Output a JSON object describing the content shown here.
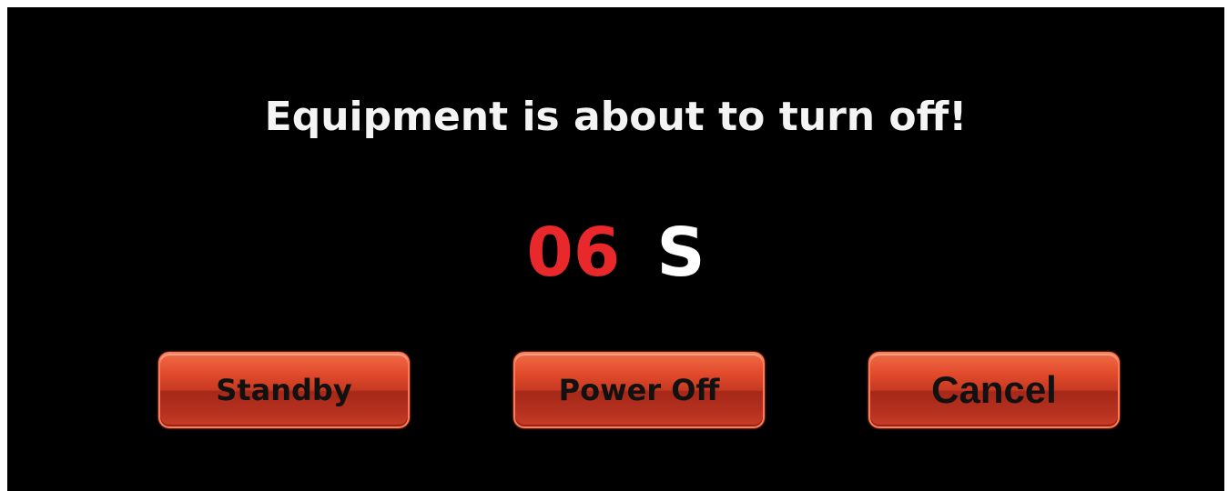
{
  "dialog": {
    "message": "Equipment is about to turn off!",
    "countdown_value": "06",
    "countdown_unit": "S"
  },
  "buttons": {
    "standby_label": "Standby",
    "power_off_label": "Power Off",
    "cancel_label": "Cancel"
  },
  "colors": {
    "background": "#000000",
    "message_text": "#f4f4f4",
    "countdown_number": "#e8282b",
    "countdown_unit": "#ffffff",
    "button_base": "#c63a22",
    "button_text": "#111111"
  }
}
